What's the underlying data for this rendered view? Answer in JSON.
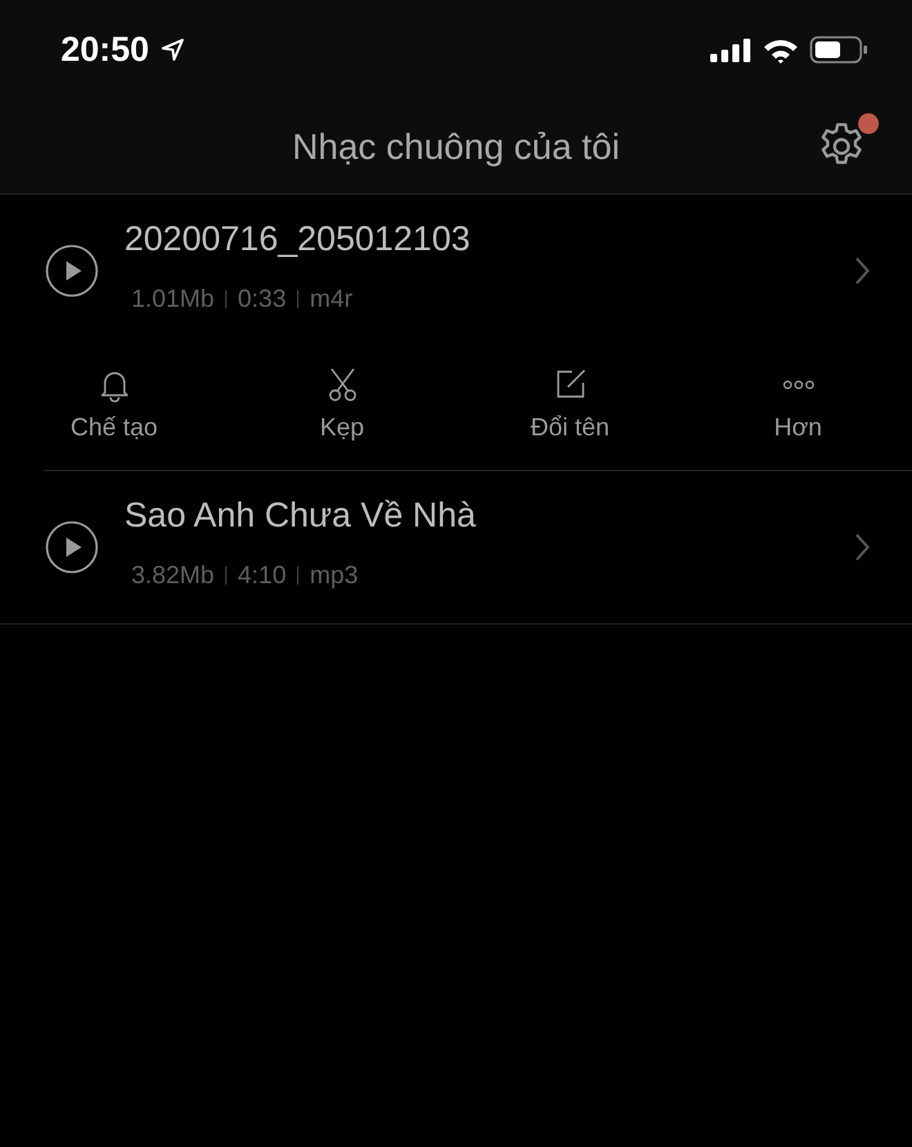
{
  "status_bar": {
    "time": "20:50"
  },
  "header": {
    "title": "Nhạc chuông của tôi",
    "settings_badge": true
  },
  "ringtones": [
    {
      "name": "20200716_205012103",
      "size": "1.01Mb",
      "duration": "0:33",
      "format": "m4r",
      "expanded": true
    },
    {
      "name": "Sao Anh Chưa Về Nhà",
      "size": "3.82Mb",
      "duration": "4:10",
      "format": "mp3",
      "expanded": false
    }
  ],
  "actions": [
    {
      "kind": "bell",
      "label": "Chế tạo"
    },
    {
      "kind": "scissors",
      "label": "Kẹp"
    },
    {
      "kind": "edit",
      "label": "Đổi tên"
    },
    {
      "kind": "more",
      "label": "Hơn"
    }
  ]
}
